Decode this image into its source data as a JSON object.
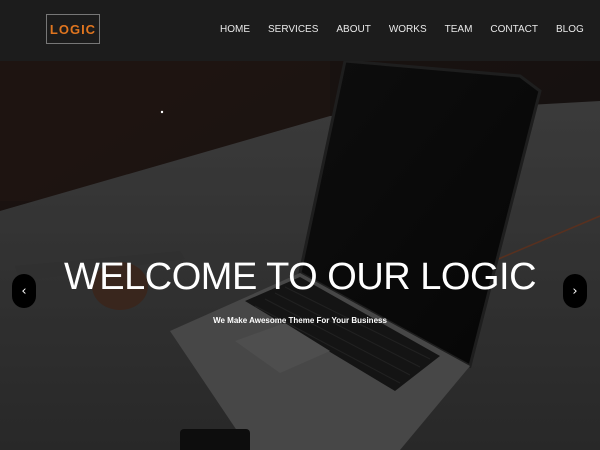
{
  "brand": {
    "logo_text": "LOGIC",
    "accent": "#e0751f"
  },
  "nav": {
    "items": [
      "HOME",
      "SERVICES",
      "ABOUT",
      "WORKS",
      "TEAM",
      "CONTACT",
      "BLOG"
    ]
  },
  "hero": {
    "title": "WELCOME TO OUR LOGIC",
    "subtitle": "We Make Awesome Theme For Your Business",
    "prev_icon": "chevron-left-icon",
    "next_icon": "chevron-right-icon",
    "prev_glyph": "‹",
    "next_glyph": "›"
  }
}
